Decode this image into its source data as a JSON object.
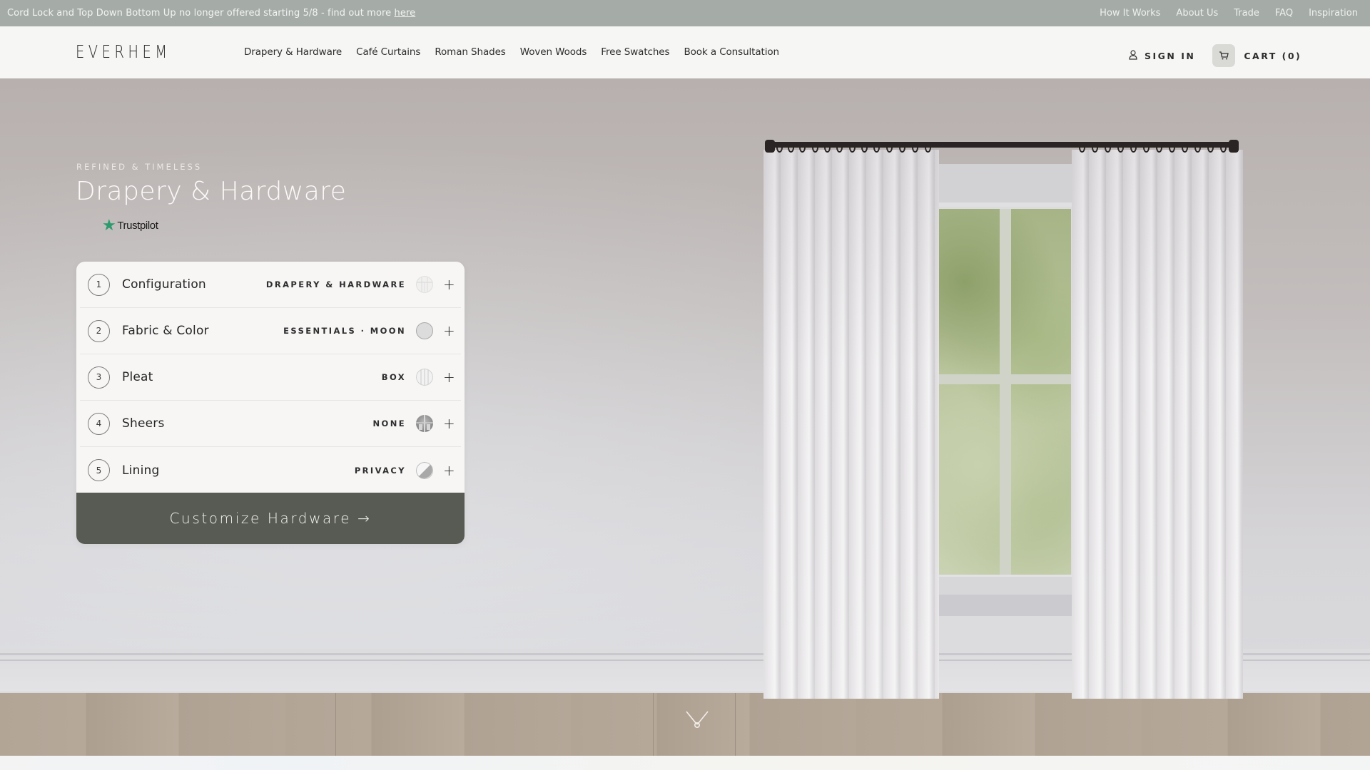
{
  "announcement": {
    "message": "Cord Lock and Top Down Bottom Up no longer offered starting 5/8 - find out more",
    "link_label": "here"
  },
  "utility_nav": [
    "How It Works",
    "About Us",
    "Trade",
    "FAQ",
    "Inspiration"
  ],
  "header": {
    "logo": "EVERHEM",
    "nav": [
      "Drapery & Hardware",
      "Café Curtains",
      "Roman Shades",
      "Woven Woods",
      "Free Swatches",
      "Book a Consultation"
    ],
    "sign_in": "SIGN IN",
    "cart": "CART (0)",
    "icons": {
      "user": "user-icon",
      "cart": "cart-icon"
    }
  },
  "hero": {
    "eyebrow": "REFINED & TIMELESS",
    "title": "Drapery & Hardware",
    "review_badge": "Trustpilot",
    "scroll_icon": "chevron-down-loop-icon"
  },
  "configurator": {
    "steps": [
      {
        "number": "1",
        "label": "Configuration",
        "value": "DRAPERY & HARDWARE",
        "thumb": "configuration-thumb"
      },
      {
        "number": "2",
        "label": "Fabric & Color",
        "value": "ESSENTIALS · MOON",
        "thumb": "fabric-swatch"
      },
      {
        "number": "3",
        "label": "Pleat",
        "value": "BOX",
        "thumb": "pleat-thumb"
      },
      {
        "number": "4",
        "label": "Sheers",
        "value": "NONE",
        "thumb": "sheers-thumb"
      },
      {
        "number": "5",
        "label": "Lining",
        "value": "PRIVACY",
        "thumb": "lining-thumb"
      }
    ],
    "expand_glyph": "+",
    "cta_label": "Customize Hardware →"
  },
  "colors": {
    "announcement_bg": "#a5aca8",
    "cta_bg": "#575b53",
    "trustpilot_star": "#2e9a6e",
    "fabric_moon": "#dcdcdc"
  }
}
